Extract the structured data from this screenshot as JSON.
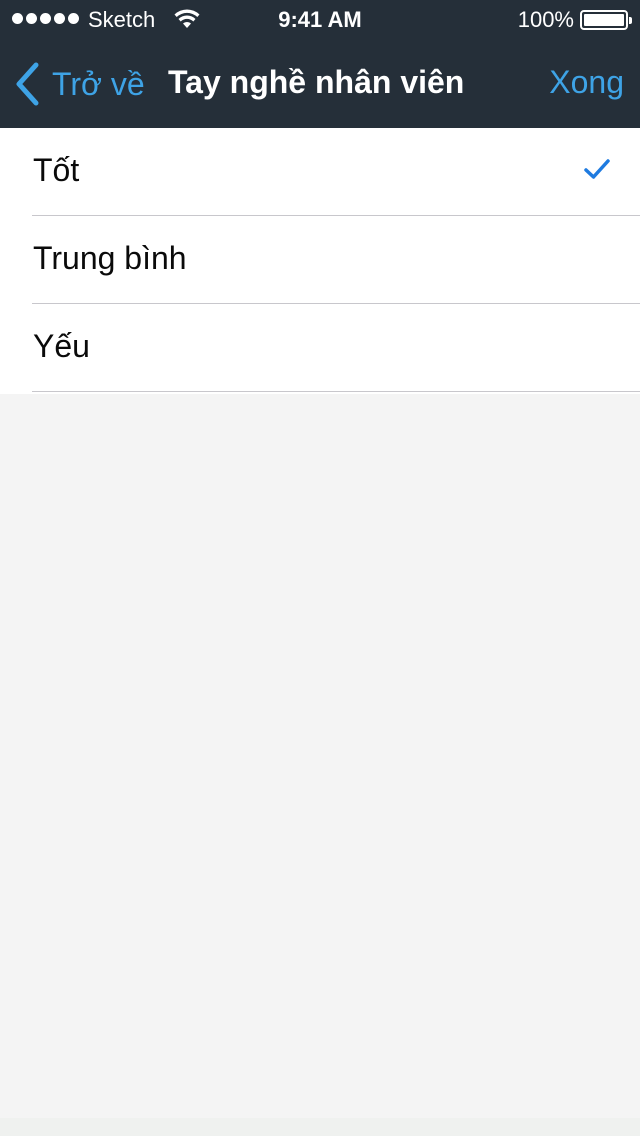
{
  "status_bar": {
    "carrier": "Sketch",
    "time": "9:41 AM",
    "battery": "100%",
    "signal_icon": "signal-dots-icon",
    "wifi_icon": "wifi-icon",
    "battery_icon": "battery-icon"
  },
  "nav": {
    "back_label": "Trở về",
    "title": "Tay nghề nhân viên",
    "done_label": "Xong",
    "back_icon": "chevron-left-icon",
    "accent_color": "#3ea3e6",
    "bar_color": "#252f39"
  },
  "options": {
    "items": [
      {
        "label": "Tốt",
        "selected": true
      },
      {
        "label": "Trung bình",
        "selected": false
      },
      {
        "label": "Yếu",
        "selected": false
      }
    ],
    "check_icon": "checkmark-icon",
    "check_color": "#1f7be0"
  }
}
